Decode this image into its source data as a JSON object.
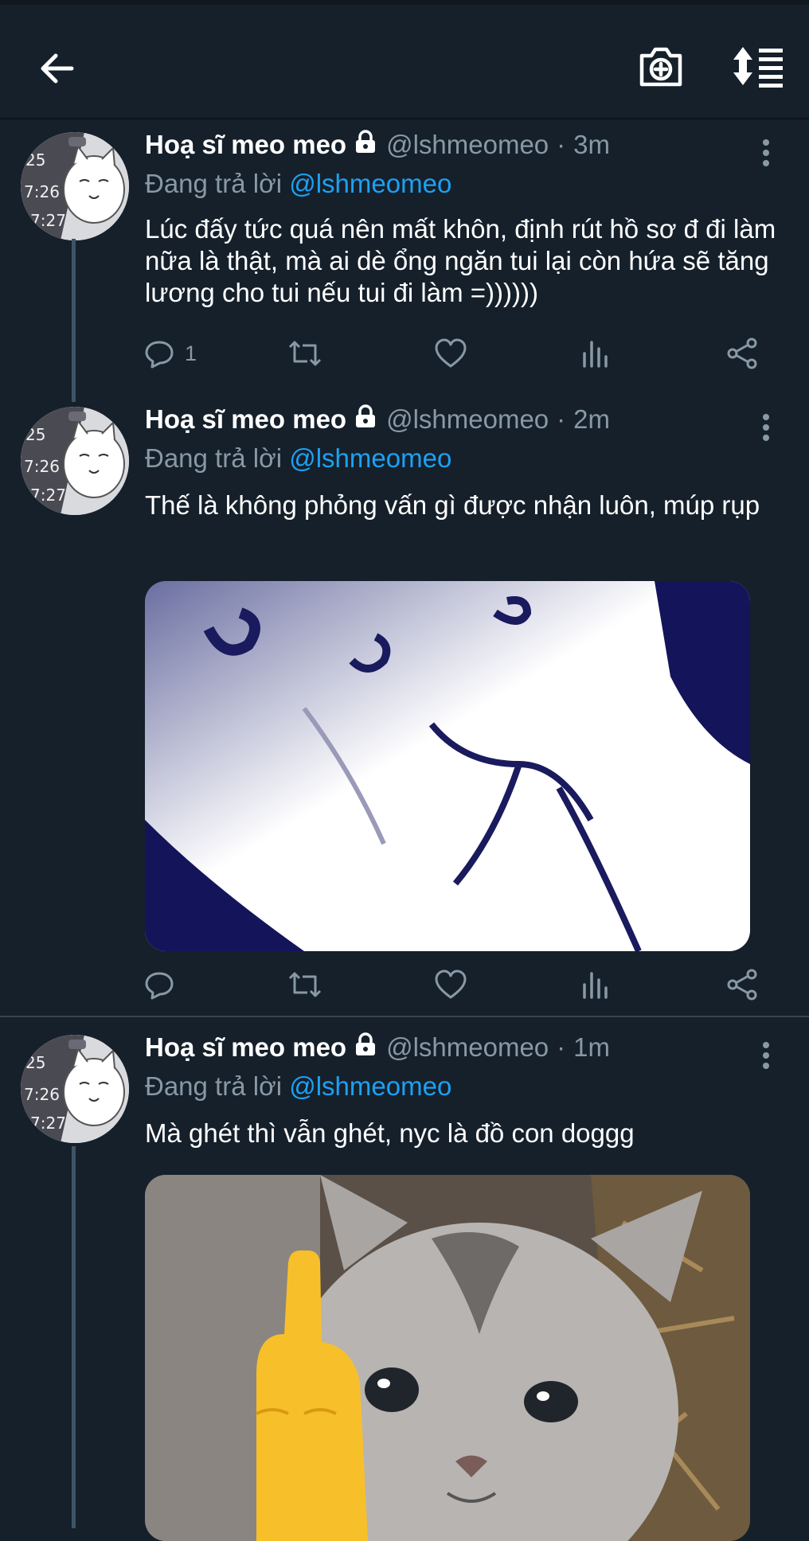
{
  "topbar": {
    "back_icon": "arrow-left-icon",
    "camera_icon": "camera-plus-icon",
    "sort_icon": "sort-list-icon"
  },
  "tweets": [
    {
      "name": "Hoạ sĩ meo meo",
      "handle": "@lshmeomeo",
      "dot": "·",
      "time": "3m",
      "reply_label": "Đang trả lời",
      "reply_to": "@lshmeomeo",
      "text": "Lúc đấy tức quá nên mất khôn, định rút hồ sơ đ đi làm nữa là thật, mà ai dè ổng ngăn tui lại còn hứa sẽ tăng lương cho tui nếu tui đi làm =))))))",
      "reply_count": "1"
    },
    {
      "name": "Hoạ sĩ meo meo",
      "handle": "@lshmeomeo",
      "dot": "·",
      "time": "2m",
      "reply_label": "Đang trả lời",
      "reply_to": "@lshmeomeo",
      "text": "Thế là không phỏng vấn gì được nhận luôn, múp rụp",
      "reply_count": ""
    },
    {
      "name": "Hoạ sĩ meo meo",
      "handle": "@lshmeomeo",
      "dot": "·",
      "time": "1m",
      "reply_label": "Đang trả lời",
      "reply_to": "@lshmeomeo",
      "text": "Mà ghét thì vẫn ghét, nyc là đồ con doggg",
      "reply_count": ""
    }
  ],
  "colors": {
    "background": "#15202b",
    "secondary_text": "#8899a6",
    "accent": "#1da1f2",
    "divider": "#38444d"
  }
}
